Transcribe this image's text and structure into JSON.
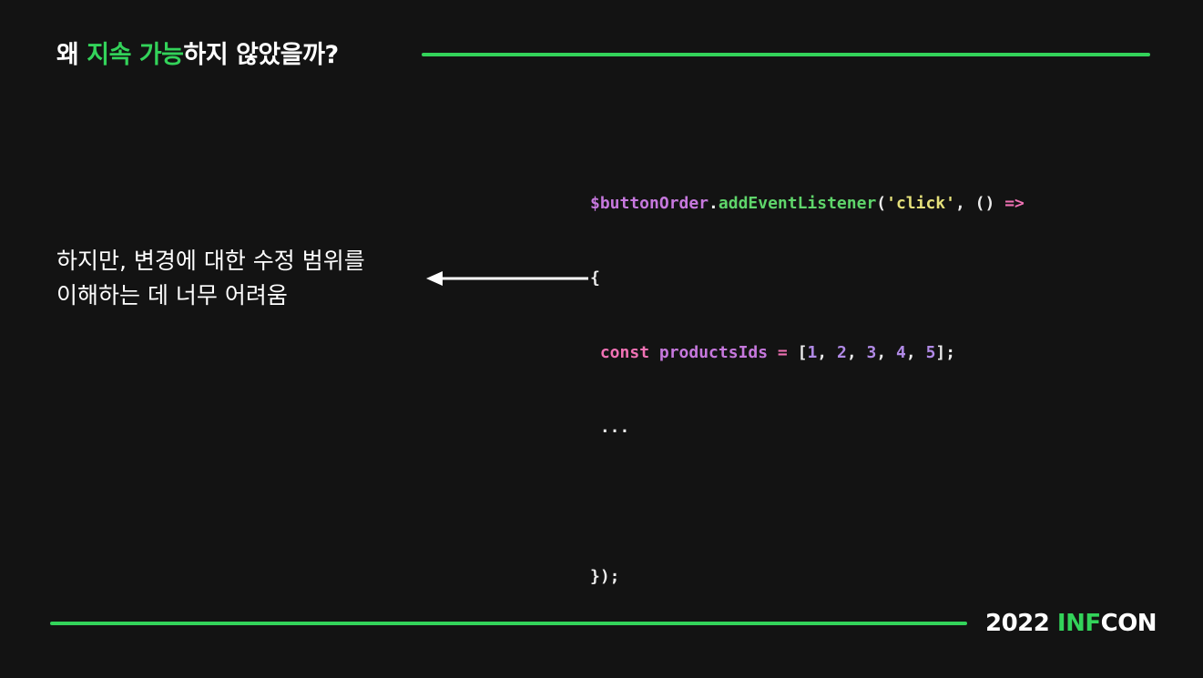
{
  "title": {
    "part1": "왜 ",
    "highlight": "지속 가능",
    "part2": "하지 않았을까?"
  },
  "caption": {
    "line1": "하지만, 변경에 대한 수정 범위를",
    "line2": "이해하는 데 너무 어려움"
  },
  "code": {
    "line1": {
      "var": "$buttonOrder",
      "dot": ".",
      "method": "addEventListener",
      "open": "(",
      "str": "'click'",
      "comma": ", ",
      "parens": "() ",
      "arrow": "=>"
    },
    "line2": "{",
    "line3": {
      "indent": " ",
      "keyword": "const",
      "name": " productsIds ",
      "eq": "=",
      "open": " [",
      "n1": "1",
      "n2": "2",
      "n3": "3",
      "n4": "4",
      "n5": "5",
      "sep": ", ",
      "close": "];"
    },
    "line4": " ...",
    "line6": "});"
  },
  "footer": {
    "year": "2022 ",
    "brand_hl": "INF",
    "brand_rest": "CON"
  },
  "colors": {
    "accent_green": "#33d35a",
    "background": "#131313"
  },
  "icons": {
    "arrow": "left-arrow-icon"
  }
}
